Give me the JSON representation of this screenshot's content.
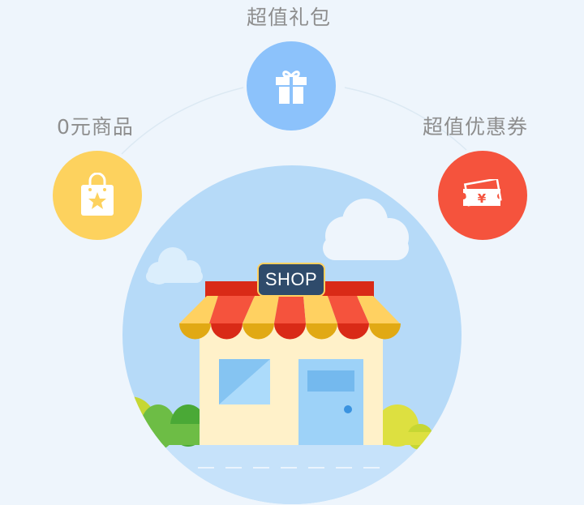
{
  "features": {
    "gift": {
      "label": "超值礼包",
      "icon": "gift-icon",
      "color": "#8cc2fb"
    },
    "free_goods": {
      "label": "0元商品",
      "icon": "shopping-bag-icon",
      "color": "#fdd25e"
    },
    "coupons": {
      "label": "超值优惠券",
      "icon": "yuan-coupon-icon",
      "color": "#f5533d"
    }
  },
  "shop": {
    "sign": "SHOP",
    "sign_color": "#2f4b6b"
  },
  "colors": {
    "background": "#eef5fc",
    "scene_sky": "#b6daf8",
    "awning_red": "#f5533d",
    "awning_yellow": "#ffd161"
  }
}
